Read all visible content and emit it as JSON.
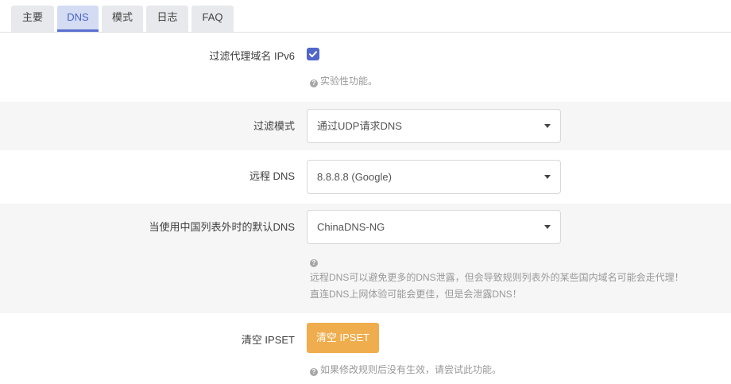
{
  "tabs": [
    {
      "label": "主要",
      "active": false
    },
    {
      "label": "DNS",
      "active": true
    },
    {
      "label": "模式",
      "active": false
    },
    {
      "label": "日志",
      "active": false
    },
    {
      "label": "FAQ",
      "active": false
    }
  ],
  "filter_ipv6": {
    "label": "过滤代理域名 IPv6",
    "checked": true,
    "hint": "实验性功能。"
  },
  "filter_mode": {
    "label": "过滤模式",
    "value": "通过UDP请求DNS"
  },
  "remote_dns": {
    "label": "远程 DNS",
    "value": "8.8.8.8 (Google)"
  },
  "default_dns": {
    "label": "当使用中国列表外时的默认DNS",
    "value": "ChinaDNS-NG",
    "hint_line1": "远程DNS可以避免更多的DNS泄露，但会导致规则列表外的某些国内域名可能会走代理！",
    "hint_line2": "直连DNS上网体验可能会更佳，但是会泄露DNS！"
  },
  "clear_ipset": {
    "label": "清空 IPSET",
    "button_label": "清空 IPSET",
    "hint": "如果修改规则后没有生效，请尝试此功能。"
  },
  "colors": {
    "accent": "#5266c9",
    "active_tab_bg": "#d3dcf3",
    "button": "#efad4d",
    "shade_row": "#f6f6f6"
  },
  "icons": {
    "hint": "question-circle-icon",
    "select": "caret-down-icon",
    "checkbox": "checkmark-icon"
  }
}
